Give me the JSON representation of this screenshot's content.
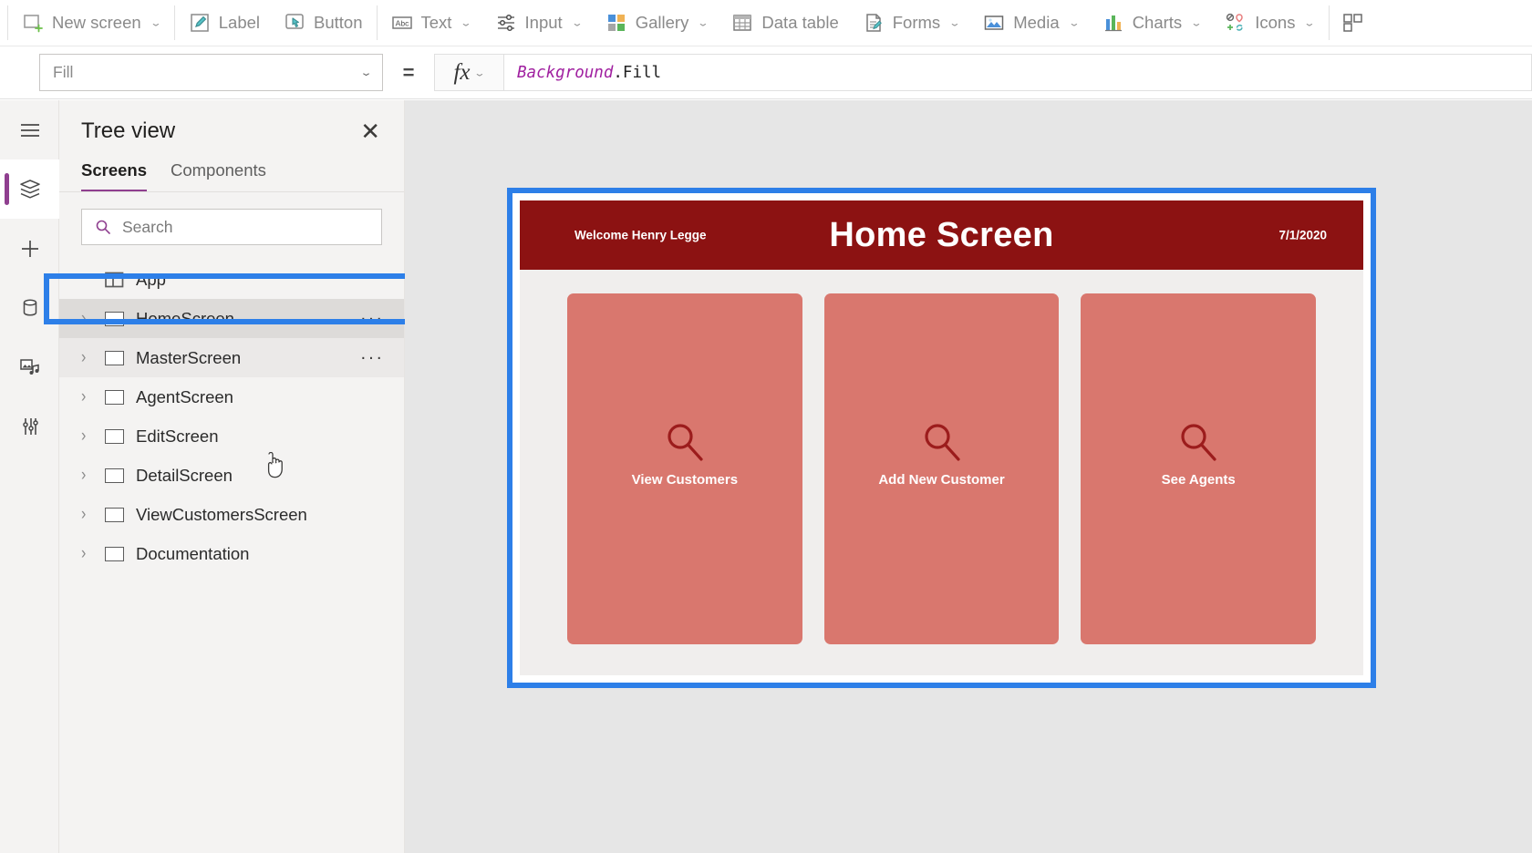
{
  "toolbar": {
    "groups": [
      {
        "items": [
          {
            "label": "New screen",
            "icon": "new-screen-icon",
            "caret": true
          }
        ]
      },
      {
        "items": [
          {
            "label": "Label",
            "icon": "label-icon",
            "caret": false
          },
          {
            "label": "Button",
            "icon": "button-icon",
            "caret": false
          }
        ]
      },
      {
        "items": [
          {
            "label": "Text",
            "icon": "text-icon",
            "caret": true
          },
          {
            "label": "Input",
            "icon": "input-icon",
            "caret": true
          },
          {
            "label": "Gallery",
            "icon": "gallery-icon",
            "caret": true
          },
          {
            "label": "Data table",
            "icon": "data-table-icon",
            "caret": false
          },
          {
            "label": "Forms",
            "icon": "forms-icon",
            "caret": true
          },
          {
            "label": "Media",
            "icon": "media-icon",
            "caret": true
          },
          {
            "label": "Charts",
            "icon": "charts-icon",
            "caret": true
          },
          {
            "label": "Icons",
            "icon": "icons-icon",
            "caret": true
          }
        ]
      }
    ]
  },
  "formula_bar": {
    "property": "Fill",
    "equals": "=",
    "fx_label": "fx",
    "formula_object": "Background",
    "formula_dot": ".",
    "formula_property": "Fill"
  },
  "rail": {
    "items": [
      {
        "name": "hamburger-menu-icon",
        "active": false
      },
      {
        "name": "tree-view-icon",
        "active": true
      },
      {
        "name": "insert-icon",
        "active": false
      },
      {
        "name": "data-icon",
        "active": false
      },
      {
        "name": "media-icon",
        "active": false
      },
      {
        "name": "advanced-tools-icon",
        "active": false
      }
    ]
  },
  "tree_view": {
    "title": "Tree view",
    "close_label": "✕",
    "tabs": [
      {
        "label": "Screens",
        "active": true
      },
      {
        "label": "Components",
        "active": false
      }
    ],
    "search_placeholder": "Search",
    "items": [
      {
        "label": "App",
        "arrow": false,
        "state": "none",
        "dots": false
      },
      {
        "label": "HomeScreen",
        "arrow": true,
        "state": "selected",
        "dots": true
      },
      {
        "label": "MasterScreen",
        "arrow": true,
        "state": "hovered",
        "dots": true
      },
      {
        "label": "AgentScreen",
        "arrow": true,
        "state": "none",
        "dots": false
      },
      {
        "label": "EditScreen",
        "arrow": true,
        "state": "none",
        "dots": false
      },
      {
        "label": "DetailScreen",
        "arrow": true,
        "state": "none",
        "dots": false
      },
      {
        "label": "ViewCustomersScreen",
        "arrow": true,
        "state": "none",
        "dots": false
      },
      {
        "label": "Documentation",
        "arrow": true,
        "state": "none",
        "dots": false
      }
    ],
    "dots_label": "···"
  },
  "preview": {
    "header": {
      "welcome": "Welcome Henry Legge",
      "title": "Home Screen",
      "date": "7/1/2020",
      "bg_color": "#8c1212",
      "text_color": "#ffffff"
    },
    "cards": [
      {
        "label": "View Customers",
        "icon": "search-icon"
      },
      {
        "label": "Add New Customer",
        "icon": "search-icon"
      },
      {
        "label": "See Agents",
        "icon": "search-icon"
      }
    ],
    "card_color": "#d9776e",
    "card_icon_color": "#9c1c1c",
    "selection_color": "#2d7fe8"
  }
}
